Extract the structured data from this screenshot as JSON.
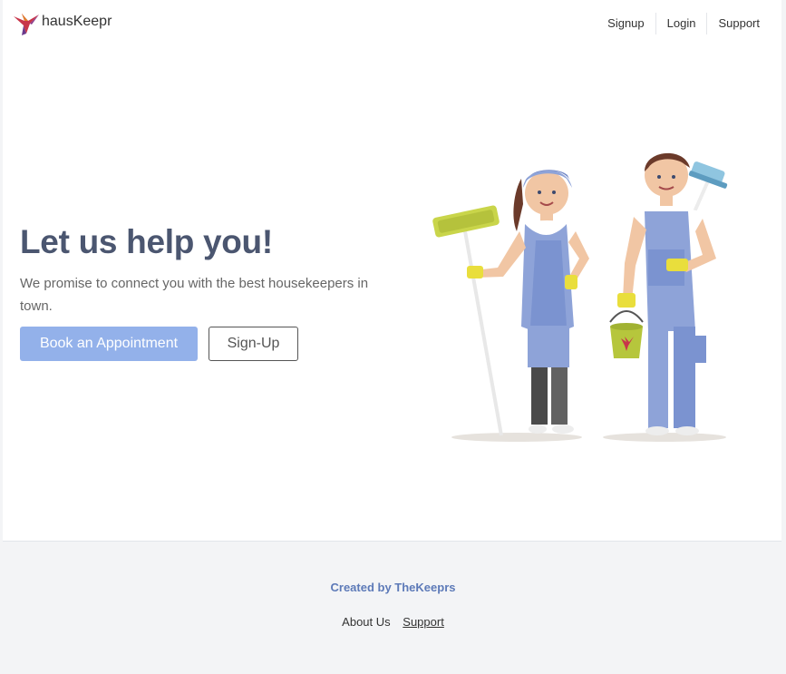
{
  "brand": {
    "name": "hausKeepr",
    "logo_icon": "hummingbird-icon"
  },
  "nav": {
    "items": [
      {
        "label": "Signup"
      },
      {
        "label": "Login"
      },
      {
        "label": "Support"
      }
    ]
  },
  "hero": {
    "title": "Let us help you!",
    "subtitle": "We promise to connect you with the best housekeepers in town.",
    "primary_button": "Book an Appointment",
    "secondary_button": "Sign-Up",
    "illustration": "housekeepers-illustration"
  },
  "footer": {
    "credit": "Created by TheKeeprs",
    "links": [
      {
        "label": "About Us"
      },
      {
        "label": "Support"
      }
    ]
  },
  "colors": {
    "accent": "#93b1ea",
    "heading": "#4b5670",
    "credit": "#5d7ab8",
    "footer_bg": "#f3f4f6"
  }
}
